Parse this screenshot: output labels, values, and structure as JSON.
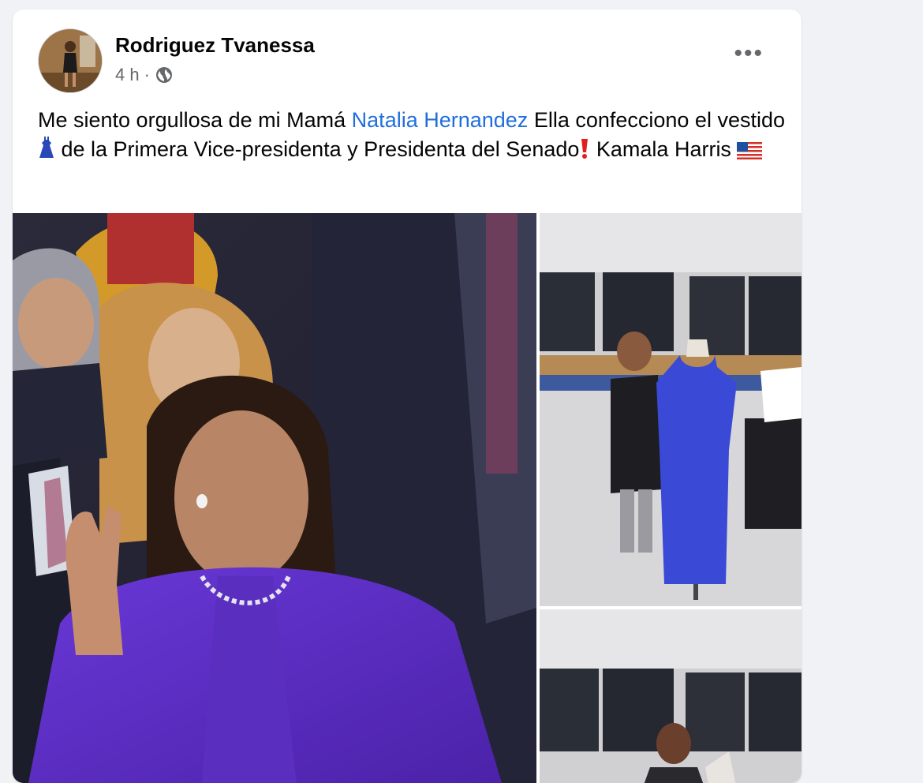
{
  "post": {
    "author": "Rodriguez Tvanessa",
    "time": "4 h",
    "separator": "·",
    "privacy_icon": "globe-icon",
    "more_icon": "more-options-icon",
    "more_label": "•••",
    "text_part1": "Me siento orgullosa de mi Mamá ",
    "mention": "Natalia Hernandez",
    "text_part2": " Ella confecciono el vestido ",
    "text_part3": " de la  Primera Vice-presidenta y Presidenta del Senado",
    "text_part4": " Kamala Harris ",
    "emoji_dress": "dress-emoji",
    "emoji_exclamation": "red-exclamation-emoji",
    "emoji_flag": "us-flag-emoji"
  },
  "colors": {
    "accent_link": "#216fdb",
    "name_text": "#050505",
    "meta_text": "#65676b",
    "page_bg": "#f0f2f5"
  },
  "photos": [
    {
      "name": "photo-inauguration"
    },
    {
      "name": "photo-dress-mannequin"
    },
    {
      "name": "photo-workshop"
    }
  ]
}
